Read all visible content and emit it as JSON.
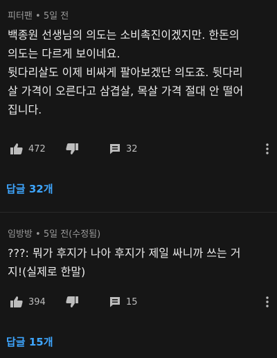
{
  "comments": [
    {
      "author": "피터팬",
      "time": "5일 전",
      "lines": [
        "백종원 선생님의 의도는 소비촉진이겠지만. 한돈의",
        "의도는 다르게 보이네요.",
        "뒷다리살도 이제 비싸게 팔아보겠단 의도죠. 뒷다리",
        "살 가격이 오른다고 삼겹살, 목살 가격 절대 안 떨어",
        "집니다."
      ],
      "likes": "472",
      "reply_count": "32",
      "replies_label": "답글 32개"
    },
    {
      "author": "임방방",
      "time": "5일 전(수정됨)",
      "lines": [
        "???: 뭐가 후지가 나아 후지가 제일 싸니까 쓰는 거",
        "지!(실제로 한말)"
      ],
      "likes": "394",
      "reply_count": "15",
      "replies_label": "답글 15개"
    }
  ],
  "separator": "•",
  "icons": {
    "like": "thumbs-up-icon",
    "dislike": "thumbs-down-icon",
    "reply": "reply-comment-icon",
    "menu": "more-vertical-icon"
  },
  "colors": {
    "background": "#161616",
    "text": "#ececec",
    "meta": "#9a9a9a",
    "link": "#3ea6ff"
  }
}
